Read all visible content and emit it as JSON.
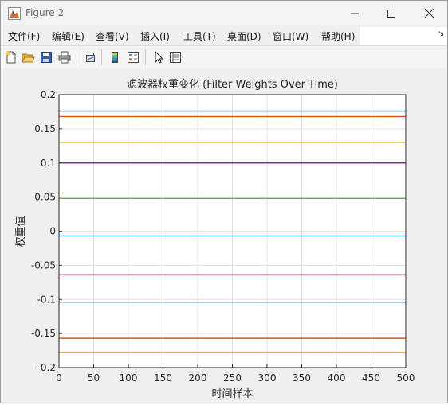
{
  "window": {
    "title": "Figure 2"
  },
  "menu": {
    "items": [
      "文件(F)",
      "编辑(E)",
      "查看(V)",
      "插入(I)",
      "工具(T)",
      "桌面(D)",
      "窗口(W)",
      "帮助(H)"
    ]
  },
  "toolbar": {
    "icons": [
      "new-figure-icon",
      "open-icon",
      "save-icon",
      "print-icon",
      "link-plot-icon",
      "colorbar-icon",
      "legend-icon",
      "pointer-icon",
      "property-inspector-icon"
    ]
  },
  "chart_data": {
    "type": "line",
    "title": "滤波器权重变化 (Filter Weights Over Time)",
    "xlabel": "时间样本",
    "ylabel": "权重值",
    "xlim": [
      0,
      500
    ],
    "ylim": [
      -0.2,
      0.2
    ],
    "x_ticks": [
      "0",
      "50",
      "100",
      "150",
      "200",
      "250",
      "300",
      "350",
      "400",
      "450",
      "500"
    ],
    "y_ticks": [
      "0.2",
      "0.15",
      "0.1",
      "0.05",
      "0",
      "-0.05",
      "-0.1",
      "-0.15",
      "-0.2"
    ],
    "grid": true,
    "series": [
      {
        "values": [
          0.176,
          0.176
        ],
        "color": "#0072BD"
      },
      {
        "values": [
          0.168,
          0.168
        ],
        "color": "#D95319"
      },
      {
        "values": [
          0.13,
          0.13
        ],
        "color": "#EDB120"
      },
      {
        "values": [
          0.1,
          0.1
        ],
        "color": "#7E2F8E"
      },
      {
        "values": [
          0.048,
          0.048
        ],
        "color": "#77AC30"
      },
      {
        "values": [
          -0.007,
          -0.007
        ],
        "color": "#4DBEEE"
      },
      {
        "values": [
          -0.064,
          -0.064
        ],
        "color": "#A2142F"
      },
      {
        "values": [
          -0.104,
          -0.104
        ],
        "color": "#0072BD"
      },
      {
        "values": [
          -0.157,
          -0.157
        ],
        "color": "#D95319"
      },
      {
        "values": [
          -0.178,
          -0.178
        ],
        "color": "#EDB120"
      }
    ],
    "x": [
      0,
      500
    ]
  }
}
